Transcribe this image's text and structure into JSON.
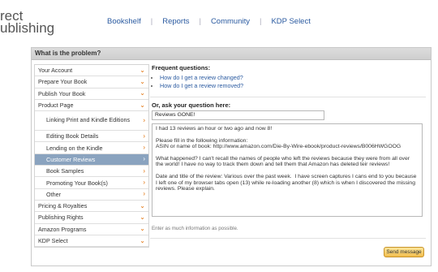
{
  "logo": {
    "line1": "rect",
    "line2": "ublishing"
  },
  "nav": {
    "items": [
      "Bookshelf",
      "Reports",
      "Community",
      "KDP Select"
    ],
    "separator": "|"
  },
  "panel": {
    "title": "What is the problem?"
  },
  "sidebar": {
    "items": [
      {
        "label": "Your Account",
        "arrow": "down"
      },
      {
        "label": "Prepare Your Book",
        "arrow": "down"
      },
      {
        "label": "Publish Your Book",
        "arrow": "down"
      },
      {
        "label": "Product Page",
        "arrow": "down"
      },
      {
        "label": "Linking Print and Kindle Editions",
        "arrow": "right"
      },
      {
        "label": "Editing Book Details",
        "arrow": "right"
      },
      {
        "label": "Lending on the Kindle",
        "arrow": "right"
      },
      {
        "label": "Customer Reviews",
        "arrow": "right"
      },
      {
        "label": "Book Samples",
        "arrow": "right"
      },
      {
        "label": "Promoting Your Book(s)",
        "arrow": "right"
      },
      {
        "label": "Other",
        "arrow": "right"
      },
      {
        "label": "Pricing & Royalties",
        "arrow": "down"
      },
      {
        "label": "Publishing Rights",
        "arrow": "down"
      },
      {
        "label": "Amazon Programs",
        "arrow": "down"
      },
      {
        "label": "KDP Select",
        "arrow": "down"
      }
    ],
    "selected": "Customer Reviews"
  },
  "faq": {
    "title": "Frequent questions:",
    "items": [
      "How do I get a review changed?",
      "How do I get a review removed?"
    ]
  },
  "ask": {
    "title": "Or, ask your question here:",
    "subject_value": "Reviews GONE!",
    "body": [
      "I had 13 reviews an hour or two ago and now 8!",
      "Please fill in the following information:\nASIN or name of book: http://www.amazon.com/Die-By-Wire-ebook/product-reviews/B006HWGOOG",
      "What happened? I can't recall the names of people who left the reviews because they were from all over the world! I have no way to track them down and tell them that Amazon has deleted teir reviews!",
      "Date and title of the review: Various over the past week.  I have screen captures I cans end to you because I left one of my browser tabs open (13) while re-loading another (8) which is when I discovered the missing reviews. Please explain."
    ],
    "helper": "Enter as much information as possible.",
    "send_label": "Send message"
  },
  "colors": {
    "link": "#2a5aa0",
    "selected_bg": "#8aa3bf",
    "arrow": "#e06c00",
    "button": "#f2bd4c"
  }
}
